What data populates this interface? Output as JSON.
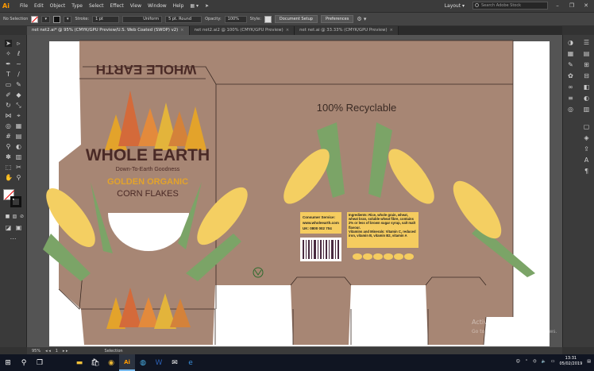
{
  "app": {
    "logo": "Ai",
    "accent": "#ff9a00"
  },
  "menu": [
    "File",
    "Edit",
    "Object",
    "Type",
    "Select",
    "Effect",
    "View",
    "Window",
    "Help"
  ],
  "workspace": {
    "label": "Layout ▾",
    "search_placeholder": "Search Adobe Stock"
  },
  "control_bar": {
    "selection": "No Selection",
    "stroke_label": "Stroke:",
    "stroke_value": "1 pt",
    "profile": "Uniform",
    "brush": "5 pt. Round",
    "opacity_label": "Opacity:",
    "opacity_value": "100%",
    "style_label": "Style:",
    "doc_setup": "Document Setup",
    "preferences": "Preferences"
  },
  "tabs": [
    {
      "label": "net net2.ai* @ 95% (CMYK/GPU Preview/U.S. Web Coated (SWOP) v2)",
      "close": "×"
    },
    {
      "label": "net net2.ai2 @ 100% (CMYK/GPU Preview)",
      "close": "×"
    },
    {
      "label": "net net.ai @ 33.33% (CMYK/GPU Preview)",
      "close": "×"
    }
  ],
  "artwork": {
    "colors": {
      "kraft": "#a78674",
      "outline": "#3a2a23",
      "brand": "#4a2a26",
      "gold": "#e3a32b",
      "corn": "#f4cf62",
      "leaf": "#7ba467",
      "label": "#f5cc5f",
      "white": "#ffffff"
    },
    "top_flap_text": "WHOLE EARTH",
    "brand": "WHOLE EARTH",
    "tagline": "Down-To-Earth Goodness",
    "product_line1": "GOLDEN ORGANIC",
    "product_line2": "CORN FLAKES",
    "recyclable": "100% Recyclable",
    "consumer_box": {
      "line1": "Consumer Service:",
      "line2": "www.wholeearth.com",
      "line3": "UK: 0800 002 704"
    },
    "ingredients": "Ingredients: Rice, whole grain, wheat, wheat bran, soluble wheat fibre, contains 2% or less of brown sugar syrup, salt malt flavour.",
    "vitamins": "Vitamins and Minerals: Vitamin C, reduced iron, vitamin B, vitamin B2, vitamin A",
    "nutrition_icons": [
      "",
      "",
      "",
      "",
      "",
      ""
    ]
  },
  "status": {
    "zoom": "95%",
    "page": "1",
    "mode": "Selection"
  },
  "watermark": {
    "line1": "Activate Windows",
    "line2": "Go to Settings to activate Windows."
  },
  "taskbar": {
    "time": "13:31",
    "date": "05/02/2019",
    "app_active": "Ai"
  }
}
